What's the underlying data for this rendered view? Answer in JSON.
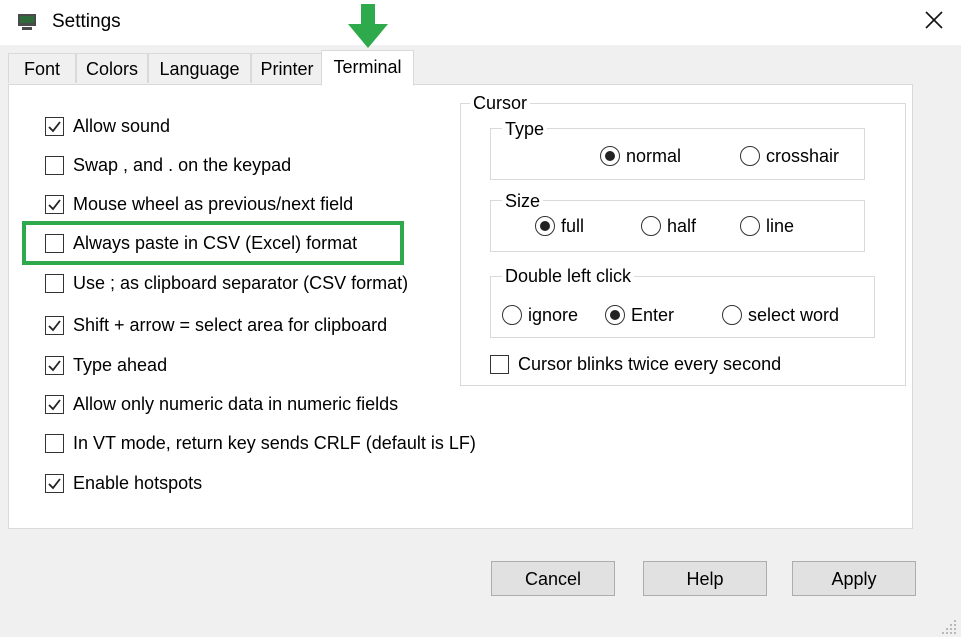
{
  "window": {
    "title": "Settings"
  },
  "tabs": [
    "Font",
    "Colors",
    "Language",
    "Printer",
    "Terminal"
  ],
  "active_tab": "Terminal",
  "options": [
    {
      "label": "Allow sound",
      "checked": true
    },
    {
      "label": "Swap , and . on the keypad",
      "checked": false
    },
    {
      "label": "Mouse wheel as previous/next field",
      "checked": true
    },
    {
      "label": "Always paste in CSV (Excel) format",
      "checked": false
    },
    {
      "label": "Use ; as clipboard separator (CSV format)",
      "checked": false
    },
    {
      "label": "Shift + arrow = select area for clipboard",
      "checked": true
    },
    {
      "label": "Type ahead",
      "checked": true
    },
    {
      "label": "Allow only numeric data in numeric fields",
      "checked": true
    },
    {
      "label": "In VT mode, return key sends CRLF (default is LF)",
      "checked": false
    },
    {
      "label": "Enable hotspots",
      "checked": true
    }
  ],
  "cursor": {
    "group_label": "Cursor",
    "type": {
      "label": "Type",
      "options": [
        "normal",
        "crosshair"
      ],
      "selected": "normal"
    },
    "size": {
      "label": "Size",
      "options": [
        "full",
        "half",
        "line"
      ],
      "selected": "full"
    },
    "double_click": {
      "label": "Double left click",
      "options": [
        "ignore",
        "Enter",
        "select word"
      ],
      "selected": "Enter"
    },
    "blink": {
      "label": "Cursor blinks twice every second",
      "checked": false
    }
  },
  "buttons": {
    "cancel": "Cancel",
    "help": "Help",
    "apply": "Apply"
  },
  "colors": {
    "highlight": "#2ea94b",
    "arrow": "#2ea94b"
  }
}
